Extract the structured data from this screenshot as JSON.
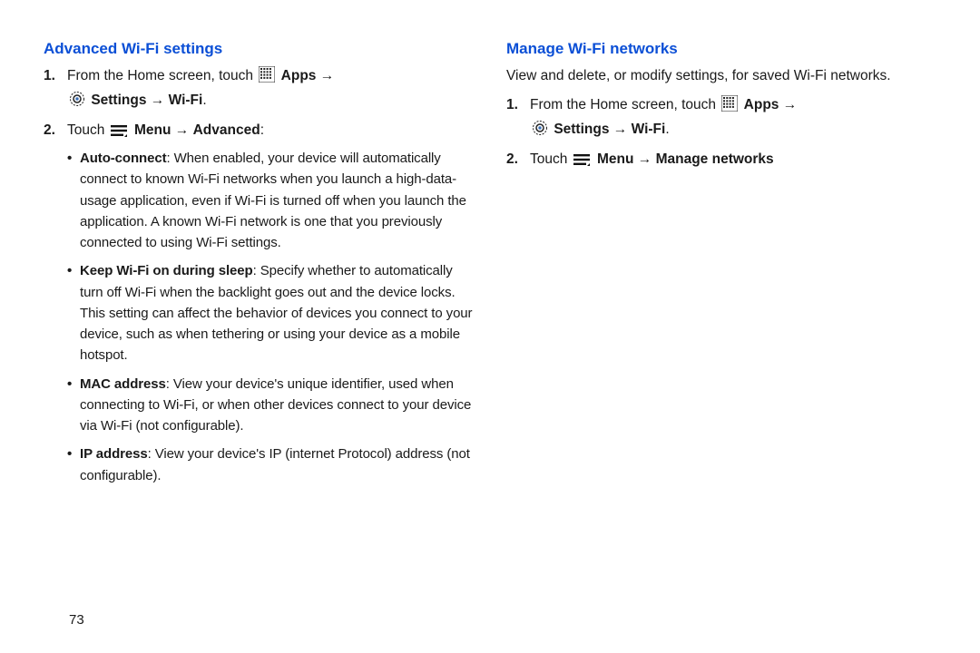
{
  "page_number": "73",
  "left": {
    "title": "Advanced Wi-Fi settings",
    "step1_prefix": "From the Home screen, touch",
    "step1_apps": "Apps",
    "step1_settings": "Settings",
    "step1_wifi": "Wi-Fi",
    "step2_prefix": "Touch",
    "step2_menu": "Menu",
    "step2_advanced": "Advanced",
    "bullets": {
      "b1_label": "Auto-connect",
      "b1_text": ": When enabled, your device will automatically connect to known Wi-Fi networks when you launch a high-data-usage application, even if Wi-Fi is turned off when you launch the application. A known Wi-Fi network is one that you previously connected to using Wi-Fi settings.",
      "b2_label": "Keep Wi-Fi on during sleep",
      "b2_text": ": Specify whether to automatically turn off Wi-Fi when the backlight goes out and the device locks. This setting can affect the behavior of devices you connect to your device, such as when tethering or using your device as a mobile hotspot.",
      "b3_label": "MAC address",
      "b3_text": ": View your device's unique identifier, used when connecting to Wi-Fi, or when other devices connect to your device via Wi-Fi (not configurable).",
      "b4_label": "IP address",
      "b4_text": ": View your device's IP (internet Protocol) address (not configurable)."
    }
  },
  "right": {
    "title": "Manage Wi-Fi networks",
    "intro": "View and delete, or modify settings, for saved Wi-Fi networks.",
    "step1_prefix": "From the Home screen, touch",
    "step1_apps": "Apps",
    "step1_settings": "Settings",
    "step1_wifi": "Wi-Fi",
    "step2_prefix": "Touch",
    "step2_menu": "Menu",
    "step2_manage": "Manage networks"
  },
  "arrow": "→",
  "period": "."
}
